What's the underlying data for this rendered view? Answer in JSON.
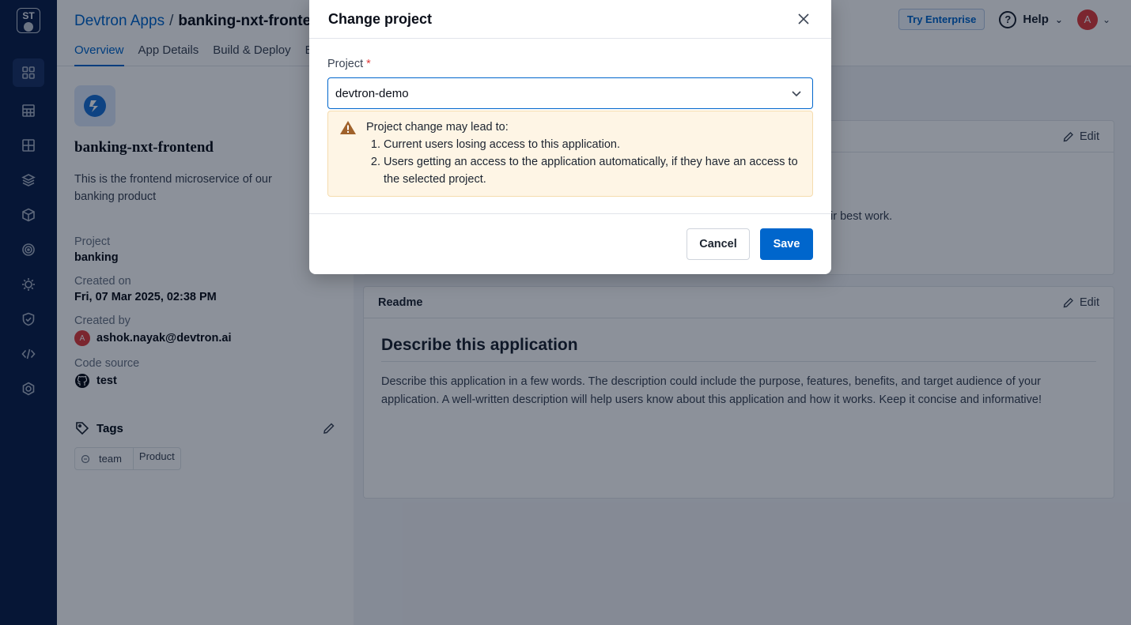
{
  "sidebar": {
    "logo_text": "ST",
    "items": [
      {
        "icon": "apps-grid-icon",
        "active": true
      },
      {
        "icon": "chart-grid-icon",
        "active": false
      },
      {
        "icon": "cluster-grid-icon",
        "active": false
      },
      {
        "icon": "stack-icon",
        "active": false
      },
      {
        "icon": "cube-icon",
        "active": false
      },
      {
        "icon": "target-icon",
        "active": false
      },
      {
        "icon": "gear-sun-icon",
        "active": false
      },
      {
        "icon": "shield-icon",
        "active": false
      },
      {
        "icon": "code-icon",
        "active": false
      },
      {
        "icon": "settings-icon",
        "active": false
      }
    ]
  },
  "header": {
    "breadcrumb_link": "Devtron Apps",
    "breadcrumb_sep": "/",
    "app_name": "banking-nxt-fronter",
    "tabs": [
      "Overview",
      "App Details",
      "Build & Deploy",
      "E"
    ],
    "try_enterprise": "Try Enterprise",
    "help": "Help",
    "avatar_letter": "A"
  },
  "overview": {
    "app_title": "banking-nxt-frontend",
    "description": "This is the frontend microservice of our banking product",
    "project_label": "Project",
    "project_value": "banking",
    "created_on_label": "Created on",
    "created_on_value": "Fri, 07 Mar 2025, 02:38 PM",
    "created_by_label": "Created by",
    "created_by_value": "ashok.nayak@devtron.ai",
    "created_by_avatar": "A",
    "code_source_label": "Code source",
    "code_source_value": "test",
    "tags_label": "Tags",
    "tag_key": "team",
    "tag_value": "Product"
  },
  "about_card": {
    "edit_label": "Edit",
    "partial_text": "ir best work."
  },
  "readme": {
    "title": "Readme",
    "edit_label": "Edit",
    "heading": "Describe this application",
    "body": "Describe this application in a few words. The description could include the purpose, features, benefits, and target audience of your application. A well-written description will help users know about this application and how it works. Keep it concise and informative!"
  },
  "modal": {
    "title": "Change project",
    "field_label": "Project",
    "required_mark": "*",
    "selected_project": "devtron-demo",
    "warning_title": "Project change may lead to:",
    "warning_items": [
      "Current users losing access to this application.",
      "Users getting an access to the application automatically, if they have an access to the selected project."
    ],
    "cancel_label": "Cancel",
    "save_label": "Save"
  },
  "colors": {
    "primary": "#0066cc",
    "sidebar": "#0b1f4a",
    "warning_bg": "#fef5e5",
    "warning_icon": "#a0622b",
    "avatar": "#e03c3c"
  }
}
